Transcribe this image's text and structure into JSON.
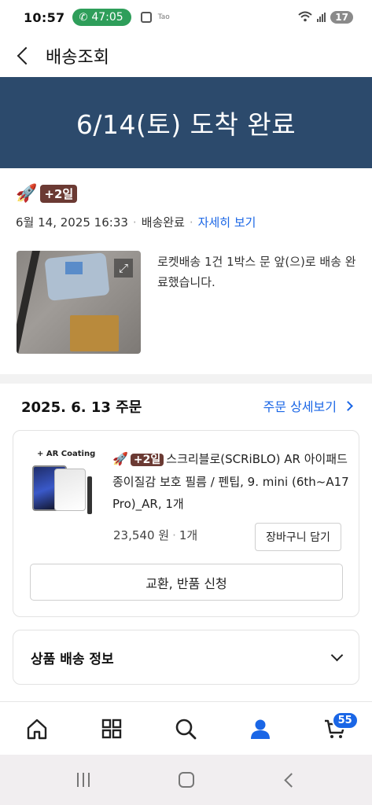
{
  "status_bar": {
    "time": "10:57",
    "call_timer": "47:05",
    "small_text": "Tao",
    "battery": "17"
  },
  "header": {
    "title": "배송조회"
  },
  "banner": {
    "text": "6/14(토) 도착 완료"
  },
  "delivery": {
    "badge": "+2일",
    "datetime": "6월 14, 2025 16:33",
    "status": "배송완료",
    "detail_link": "자세히 보기",
    "message": "로켓배송 1건 1박스 문 앞(으)로 배송 완료했습니다."
  },
  "order": {
    "date": "2025. 6. 13 주문",
    "detail_link": "주문 상세보기",
    "product": {
      "thumb_label": "+ AR Coating",
      "badge": "+2일",
      "name": "스크리블로(SCRiBLO) AR 아이패드 종이질감 보호 필름 / 펜팁, 9. mini (6th~A17 Pro)_AR, 1개",
      "price": "23,540 원",
      "quantity": "1개",
      "cart_button": "장바구니 담기",
      "exchange_button": "교환, 반품 신청"
    },
    "shipping_info_label": "상품 배송 정보"
  },
  "bottom_nav": {
    "cart_badge": "55",
    "icons": [
      "home-icon",
      "category-icon",
      "search-icon",
      "profile-icon",
      "cart-icon"
    ]
  },
  "colors": {
    "banner": "#2c4a6c",
    "link": "#1a66e6",
    "rocket_badge": "#6b3a33"
  }
}
